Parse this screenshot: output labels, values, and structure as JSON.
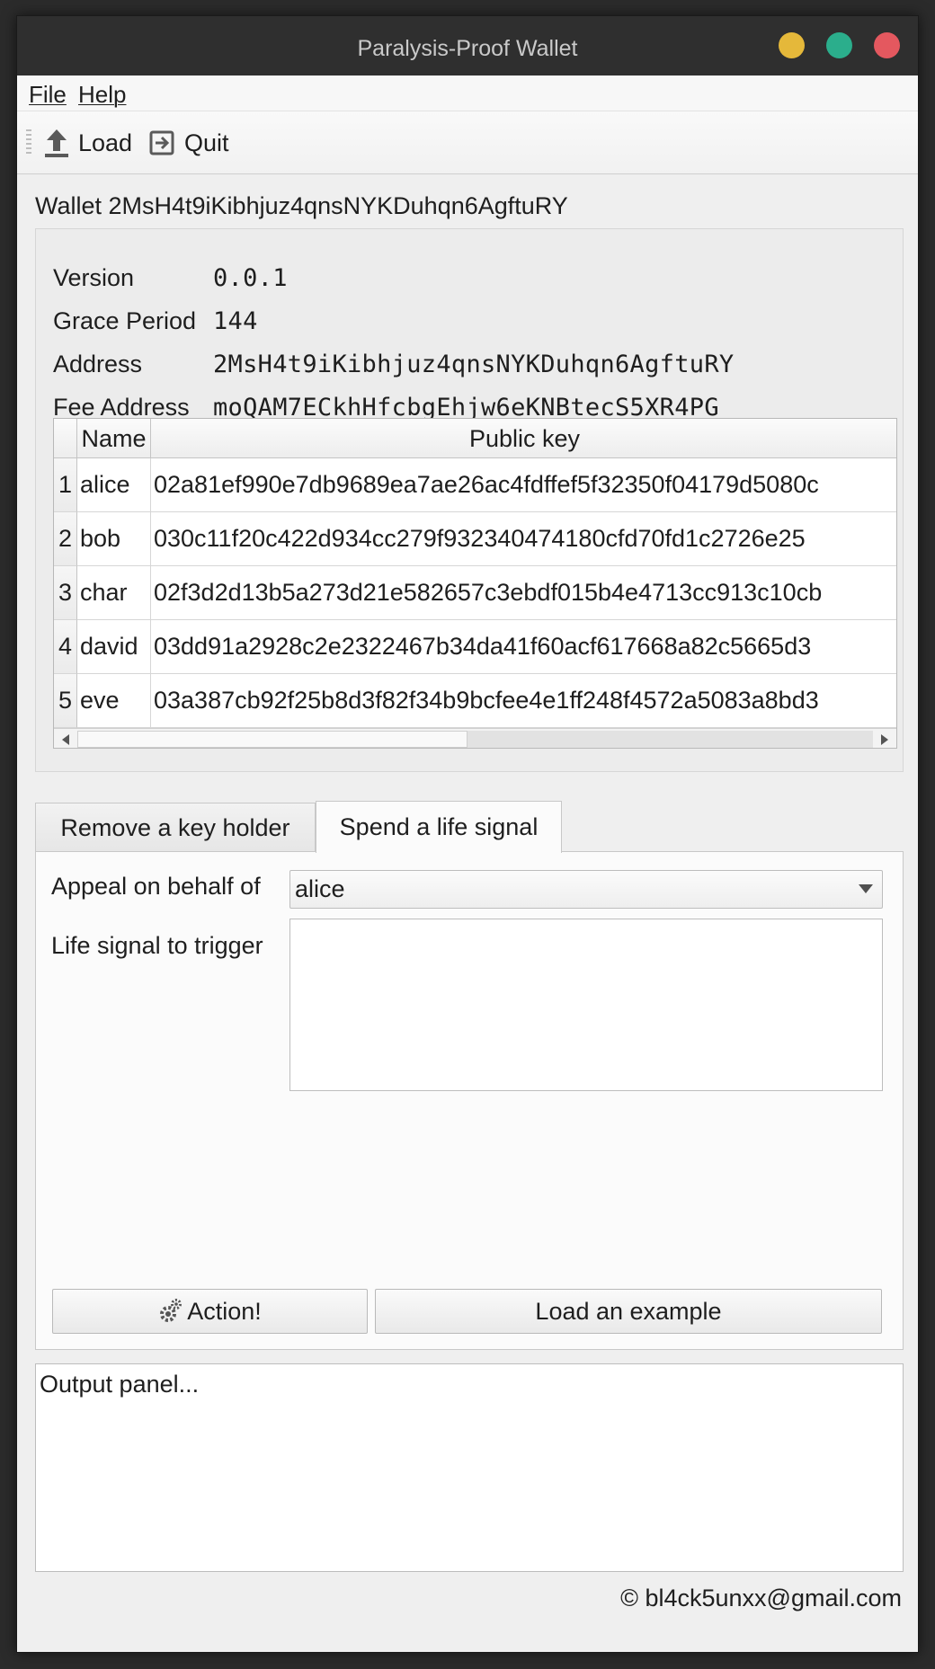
{
  "window": {
    "title": "Paralysis-Proof Wallet",
    "controls": {
      "minimize_color": "#e5b83a",
      "maximize_color": "#2bae8c",
      "close_color": "#e4585f"
    }
  },
  "menubar": {
    "items": [
      {
        "label": "File"
      },
      {
        "label": "Help"
      }
    ]
  },
  "toolbar": {
    "load_label": "Load",
    "quit_label": "Quit",
    "icons": {
      "load": "upload-icon",
      "quit": "exit-icon"
    }
  },
  "wallet": {
    "title": "Wallet 2MsH4t9iKibhjuz4qnsNYKDuhqn6AgftuRY",
    "info": [
      {
        "label": "Version",
        "value": "0.0.1"
      },
      {
        "label": "Grace Period",
        "value": "144"
      },
      {
        "label": "Address",
        "value": "2MsH4t9iKibhjuz4qnsNYKDuhqn6AgftuRY"
      },
      {
        "label": "Fee Address",
        "value": "moQAM7ECkhHfcbgEhjw6eKNBtecS5XR4PG"
      }
    ],
    "table": {
      "headers": {
        "name": "Name",
        "public_key": "Public key"
      },
      "rows": [
        {
          "index": "1",
          "name": "alice",
          "public_key": "02a81ef990e7db9689ea7ae26ac4fdffef5f32350f04179d5080c"
        },
        {
          "index": "2",
          "name": "bob",
          "public_key": "030c11f20c422d934cc279f932340474180cfd70fd1c2726e25"
        },
        {
          "index": "3",
          "name": "char",
          "public_key": "02f3d2d13b5a273d21e582657c3ebdf015b4e4713cc913c10cb"
        },
        {
          "index": "4",
          "name": "david",
          "public_key": "03dd91a2928c2e2322467b34da41f60acf617668a82c5665d3"
        },
        {
          "index": "5",
          "name": "eve",
          "public_key": "03a387cb92f25b8d3f82f34b9bcfee4e1ff248f4572a5083a8bd3"
        }
      ]
    }
  },
  "tabs": [
    {
      "label": "Remove a key holder",
      "active": false
    },
    {
      "label": "Spend a life signal",
      "active": true
    }
  ],
  "form": {
    "appeal_label": "Appeal on behalf of",
    "appeal_value": "alice",
    "life_signal_label": "Life signal to trigger",
    "life_signal_value": "",
    "action_label": "Action!",
    "action_icon": "gears-icon",
    "load_example_label": "Load an example"
  },
  "output": {
    "placeholder": "Output panel..."
  },
  "footer": {
    "text": "© bl4ck5unxx@gmail.com"
  }
}
